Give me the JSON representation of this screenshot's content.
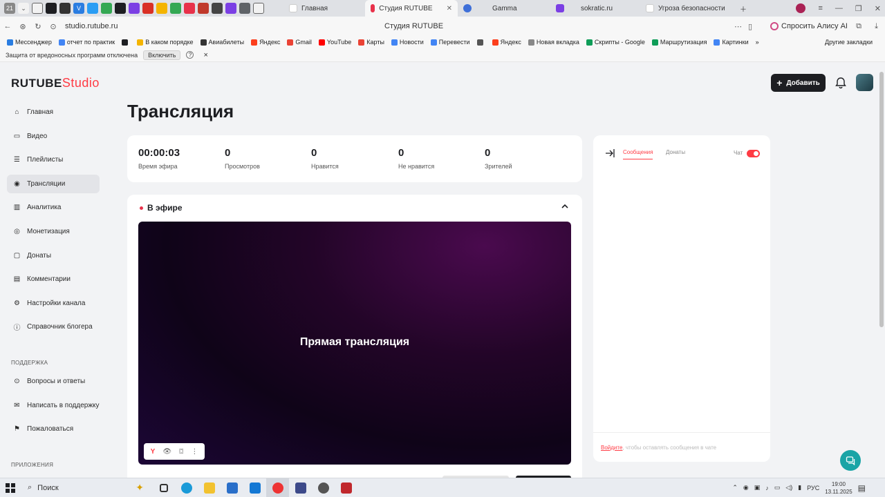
{
  "browser": {
    "tab_counter": "21",
    "tabs": [
      {
        "label": "Главная",
        "active": false,
        "color": "#ffffff"
      },
      {
        "label": "Студия RUTUBE",
        "active": true,
        "color": "#e8314a"
      },
      {
        "label": "Gamma",
        "active": false,
        "color": "#3e6fd8"
      },
      {
        "label": "sokratic.ru",
        "active": false,
        "color": "#7b3fe4"
      },
      {
        "label": "Угроза безопасности",
        "active": false,
        "color": "#ffffff"
      }
    ],
    "url": "studio.rutube.ru",
    "page_title": "Студия RUTUBE",
    "alice_label": "Спросить Алису AI",
    "bookmarks": [
      {
        "label": "Мессенджер",
        "color": "#2a7de1"
      },
      {
        "label": "отчет по практик",
        "color": "#4285f4"
      },
      {
        "label": "",
        "color": "#1d1e22"
      },
      {
        "label": "В каком порядке",
        "color": "#f4b400"
      },
      {
        "label": "Авиабилеты",
        "color": "#333333"
      },
      {
        "label": "Яндекс",
        "color": "#fc3f1d"
      },
      {
        "label": "Gmail",
        "color": "#ea4335"
      },
      {
        "label": "YouTube",
        "color": "#ff0000"
      },
      {
        "label": "Карты",
        "color": "#ea4335"
      },
      {
        "label": "Новости",
        "color": "#4285f4"
      },
      {
        "label": "Перевести",
        "color": "#4285f4"
      },
      {
        "label": "",
        "color": "#555555"
      },
      {
        "label": "Яндекс",
        "color": "#fc3f1d"
      },
      {
        "label": "Новая вкладка",
        "color": "#888888"
      },
      {
        "label": "Скрипты - Google",
        "color": "#0f9d58"
      },
      {
        "label": "Маршрутизация",
        "color": "#0f9d58"
      },
      {
        "label": "Картинки",
        "color": "#4285f4"
      }
    ],
    "bookmarks_more": "»",
    "other_bookmarks": "Другие закладки",
    "notice_text": "Защита от вредоносных программ отключена",
    "notice_button": "Включить",
    "notice_help": "?",
    "notice_close": "×"
  },
  "brand": {
    "name": "RUTUBE",
    "suffix": "Studio",
    "accent": "#ff3b44"
  },
  "sidebar": {
    "items": [
      {
        "label": "Главная",
        "icon": "home-icon",
        "active": false
      },
      {
        "label": "Видео",
        "icon": "video-icon",
        "active": false
      },
      {
        "label": "Плейлисты",
        "icon": "playlist-icon",
        "active": false
      },
      {
        "label": "Трансляции",
        "icon": "broadcast-icon",
        "active": true
      },
      {
        "label": "Аналитика",
        "icon": "analytics-icon",
        "active": false
      },
      {
        "label": "Монетизация",
        "icon": "coin-icon",
        "active": false
      },
      {
        "label": "Донаты",
        "icon": "donate-icon",
        "active": false
      },
      {
        "label": "Комментарии",
        "icon": "comment-icon",
        "active": false
      },
      {
        "label": "Настройки канала",
        "icon": "gear-icon",
        "active": false
      },
      {
        "label": "Справочник блогера",
        "icon": "info-icon",
        "active": false
      }
    ],
    "support_label": "ПОДДЕРЖКА",
    "support_items": [
      {
        "label": "Вопросы и ответы",
        "icon": "question-icon"
      },
      {
        "label": "Написать в поддержку",
        "icon": "mail-icon"
      },
      {
        "label": "Пожаловаться",
        "icon": "flag-icon"
      }
    ],
    "apps_label": "ПРИЛОЖЕНИЯ"
  },
  "header": {
    "add_label": "Добавить"
  },
  "page": {
    "title": "Трансляция"
  },
  "stats": [
    {
      "value": "00:00:03",
      "label": "Время эфира"
    },
    {
      "value": "0",
      "label": "Просмотров"
    },
    {
      "value": "0",
      "label": "Нравится"
    },
    {
      "value": "0",
      "label": "Не нравится"
    },
    {
      "value": "0",
      "label": "Зрителей"
    }
  ],
  "live": {
    "status_label": "В эфире",
    "player_title": "Прямая трансляция",
    "controls": [
      "Y",
      "eye-icon",
      "screenshot-icon",
      "more-icon"
    ]
  },
  "chat": {
    "tabs": [
      {
        "label": "Сообщения",
        "active": true
      },
      {
        "label": "Донаты",
        "active": false
      }
    ],
    "toggle_label": "Чат",
    "toggle_on": true,
    "login_link": "Войдите",
    "login_text": ", чтобы оставлять сообщения в чате"
  },
  "taskbar": {
    "search_placeholder": "Поиск",
    "lang": "РУС",
    "time": "19:00",
    "date": "13.11.2025"
  }
}
